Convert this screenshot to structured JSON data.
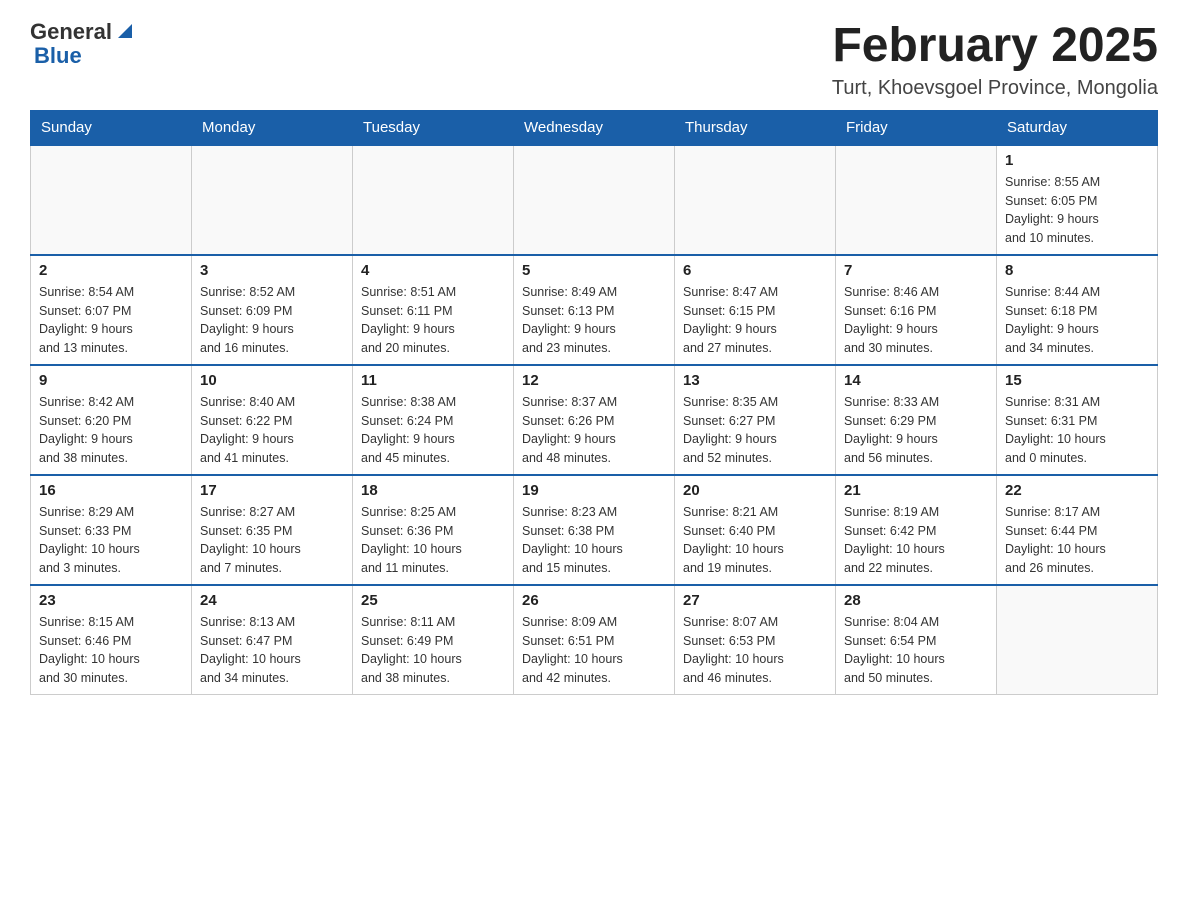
{
  "header": {
    "logo_general": "General",
    "logo_blue": "Blue",
    "month_title": "February 2025",
    "location": "Turt, Khoevsgoel Province, Mongolia"
  },
  "weekdays": [
    "Sunday",
    "Monday",
    "Tuesday",
    "Wednesday",
    "Thursday",
    "Friday",
    "Saturday"
  ],
  "weeks": [
    [
      {
        "day": "",
        "info": ""
      },
      {
        "day": "",
        "info": ""
      },
      {
        "day": "",
        "info": ""
      },
      {
        "day": "",
        "info": ""
      },
      {
        "day": "",
        "info": ""
      },
      {
        "day": "",
        "info": ""
      },
      {
        "day": "1",
        "info": "Sunrise: 8:55 AM\nSunset: 6:05 PM\nDaylight: 9 hours\nand 10 minutes."
      }
    ],
    [
      {
        "day": "2",
        "info": "Sunrise: 8:54 AM\nSunset: 6:07 PM\nDaylight: 9 hours\nand 13 minutes."
      },
      {
        "day": "3",
        "info": "Sunrise: 8:52 AM\nSunset: 6:09 PM\nDaylight: 9 hours\nand 16 minutes."
      },
      {
        "day": "4",
        "info": "Sunrise: 8:51 AM\nSunset: 6:11 PM\nDaylight: 9 hours\nand 20 minutes."
      },
      {
        "day": "5",
        "info": "Sunrise: 8:49 AM\nSunset: 6:13 PM\nDaylight: 9 hours\nand 23 minutes."
      },
      {
        "day": "6",
        "info": "Sunrise: 8:47 AM\nSunset: 6:15 PM\nDaylight: 9 hours\nand 27 minutes."
      },
      {
        "day": "7",
        "info": "Sunrise: 8:46 AM\nSunset: 6:16 PM\nDaylight: 9 hours\nand 30 minutes."
      },
      {
        "day": "8",
        "info": "Sunrise: 8:44 AM\nSunset: 6:18 PM\nDaylight: 9 hours\nand 34 minutes."
      }
    ],
    [
      {
        "day": "9",
        "info": "Sunrise: 8:42 AM\nSunset: 6:20 PM\nDaylight: 9 hours\nand 38 minutes."
      },
      {
        "day": "10",
        "info": "Sunrise: 8:40 AM\nSunset: 6:22 PM\nDaylight: 9 hours\nand 41 minutes."
      },
      {
        "day": "11",
        "info": "Sunrise: 8:38 AM\nSunset: 6:24 PM\nDaylight: 9 hours\nand 45 minutes."
      },
      {
        "day": "12",
        "info": "Sunrise: 8:37 AM\nSunset: 6:26 PM\nDaylight: 9 hours\nand 48 minutes."
      },
      {
        "day": "13",
        "info": "Sunrise: 8:35 AM\nSunset: 6:27 PM\nDaylight: 9 hours\nand 52 minutes."
      },
      {
        "day": "14",
        "info": "Sunrise: 8:33 AM\nSunset: 6:29 PM\nDaylight: 9 hours\nand 56 minutes."
      },
      {
        "day": "15",
        "info": "Sunrise: 8:31 AM\nSunset: 6:31 PM\nDaylight: 10 hours\nand 0 minutes."
      }
    ],
    [
      {
        "day": "16",
        "info": "Sunrise: 8:29 AM\nSunset: 6:33 PM\nDaylight: 10 hours\nand 3 minutes."
      },
      {
        "day": "17",
        "info": "Sunrise: 8:27 AM\nSunset: 6:35 PM\nDaylight: 10 hours\nand 7 minutes."
      },
      {
        "day": "18",
        "info": "Sunrise: 8:25 AM\nSunset: 6:36 PM\nDaylight: 10 hours\nand 11 minutes."
      },
      {
        "day": "19",
        "info": "Sunrise: 8:23 AM\nSunset: 6:38 PM\nDaylight: 10 hours\nand 15 minutes."
      },
      {
        "day": "20",
        "info": "Sunrise: 8:21 AM\nSunset: 6:40 PM\nDaylight: 10 hours\nand 19 minutes."
      },
      {
        "day": "21",
        "info": "Sunrise: 8:19 AM\nSunset: 6:42 PM\nDaylight: 10 hours\nand 22 minutes."
      },
      {
        "day": "22",
        "info": "Sunrise: 8:17 AM\nSunset: 6:44 PM\nDaylight: 10 hours\nand 26 minutes."
      }
    ],
    [
      {
        "day": "23",
        "info": "Sunrise: 8:15 AM\nSunset: 6:46 PM\nDaylight: 10 hours\nand 30 minutes."
      },
      {
        "day": "24",
        "info": "Sunrise: 8:13 AM\nSunset: 6:47 PM\nDaylight: 10 hours\nand 34 minutes."
      },
      {
        "day": "25",
        "info": "Sunrise: 8:11 AM\nSunset: 6:49 PM\nDaylight: 10 hours\nand 38 minutes."
      },
      {
        "day": "26",
        "info": "Sunrise: 8:09 AM\nSunset: 6:51 PM\nDaylight: 10 hours\nand 42 minutes."
      },
      {
        "day": "27",
        "info": "Sunrise: 8:07 AM\nSunset: 6:53 PM\nDaylight: 10 hours\nand 46 minutes."
      },
      {
        "day": "28",
        "info": "Sunrise: 8:04 AM\nSunset: 6:54 PM\nDaylight: 10 hours\nand 50 minutes."
      },
      {
        "day": "",
        "info": ""
      }
    ]
  ]
}
